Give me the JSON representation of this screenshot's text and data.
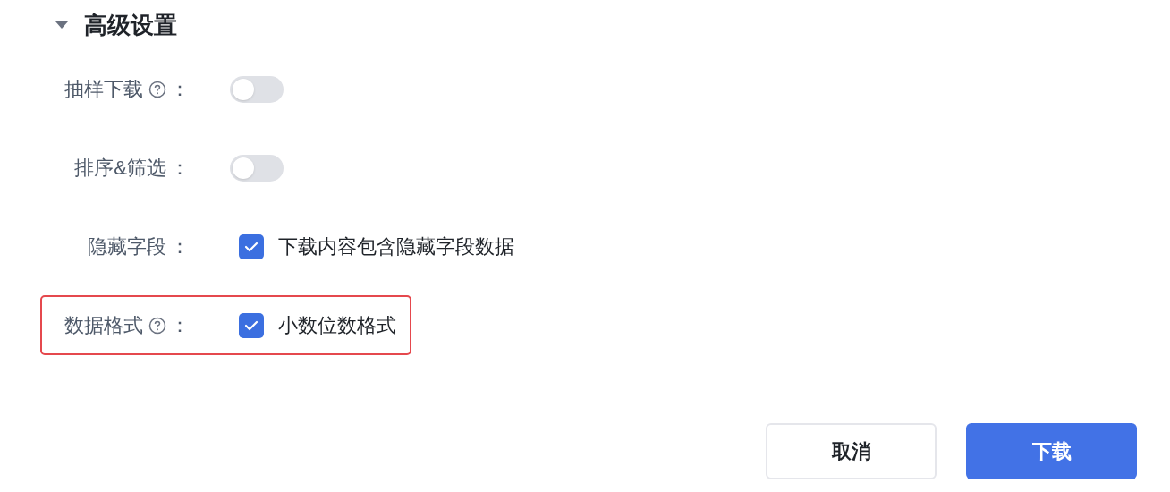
{
  "section": {
    "title": "高级设置",
    "expanded": true
  },
  "rows": [
    {
      "kind": "toggle",
      "label": "抽样下载",
      "help": true,
      "colon": "：",
      "on": false,
      "highlighted": false
    },
    {
      "kind": "toggle",
      "label": "排序&筛选",
      "help": false,
      "colon": "：",
      "on": false,
      "highlighted": false
    },
    {
      "kind": "checkbox",
      "label": "隐藏字段",
      "help": false,
      "colon": "：",
      "checked": true,
      "text": "下载内容包含隐藏字段数据",
      "highlighted": false
    },
    {
      "kind": "checkbox",
      "label": "数据格式",
      "help": true,
      "colon": "：",
      "checked": true,
      "text": "小数位数格式",
      "highlighted": true
    }
  ],
  "buttons": [
    {
      "label": "取消",
      "kind": "secondary"
    },
    {
      "label": "下载",
      "kind": "primary"
    }
  ]
}
